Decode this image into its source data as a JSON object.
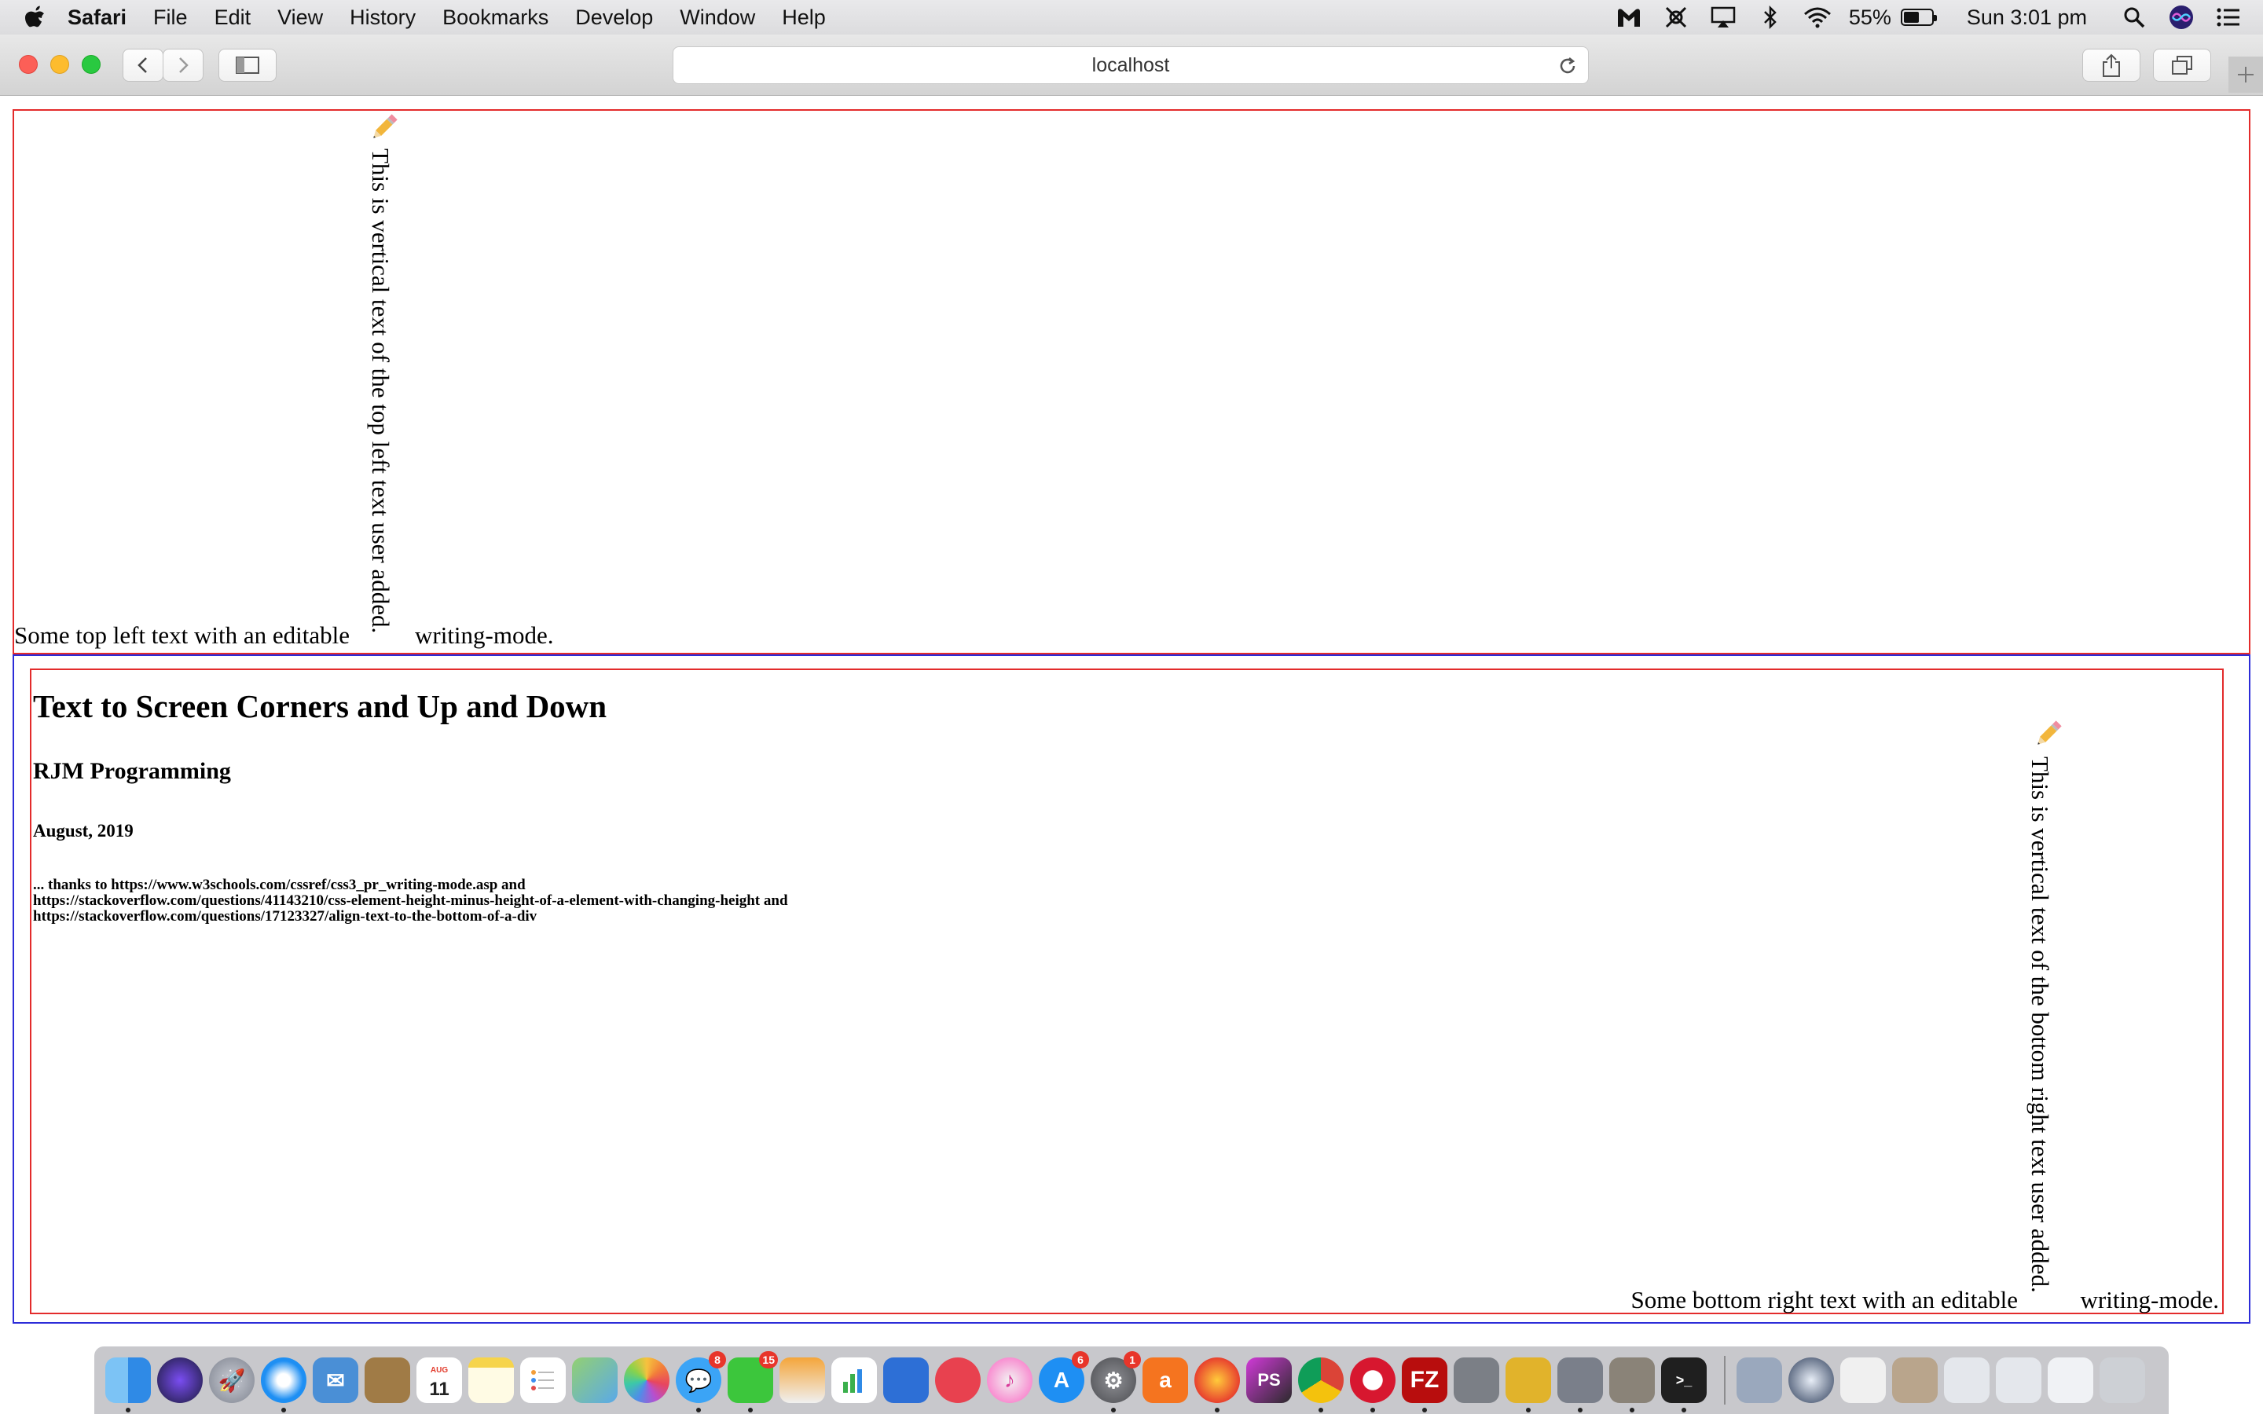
{
  "menubar": {
    "app_name": "Safari",
    "items": [
      "File",
      "Edit",
      "View",
      "History",
      "Bookmarks",
      "Develop",
      "Window",
      "Help"
    ],
    "battery_percent": "55%",
    "clock": "Sun 3:01 pm",
    "battery_level": 0.55
  },
  "toolbar": {
    "address": "localhost"
  },
  "page": {
    "top_left_text": "Some top left text with an editable",
    "top_left_vertical": "This is vertical text of the top left text user added.",
    "top_left_end": "writing-mode.",
    "heading": "Text to Screen Corners and Up and Down",
    "subheading": "RJM Programming",
    "date": "August, 2019",
    "thanks_lines": [
      "... thanks to https://www.w3schools.com/cssref/css3_pr_writing-mode.asp and",
      "https://stackoverflow.com/questions/41143210/css-element-height-minus-height-of-a-element-with-changing-height and",
      "https://stackoverflow.com/questions/17123327/align-text-to-the-bottom-of-a-div"
    ],
    "bottom_right_text": "Some bottom right text with an editable",
    "bottom_right_vertical": "This is vertical text of the bottom right text user added.",
    "bottom_right_end": "writing-mode."
  },
  "dock": {
    "badges": {
      "messages": "8",
      "facetime": "15",
      "appstore": "6",
      "prefs": "1"
    },
    "calendar_month": "AUG",
    "calendar_day": "11"
  },
  "colors": {
    "box_red": "#e32b2b",
    "box_blue": "#2c2cd8"
  }
}
